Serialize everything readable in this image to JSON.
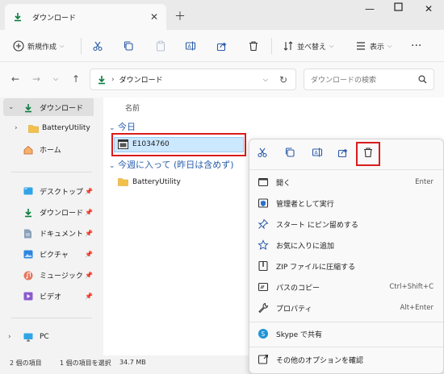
{
  "window": {
    "tab_title": "ダウンロード"
  },
  "toolbar": {
    "new_label": "新規作成",
    "sort_label": "並べ替え",
    "view_label": "表示"
  },
  "address": {
    "path": "ダウンロード",
    "search_placeholder": "ダウンロードの検索"
  },
  "nav": {
    "items": [
      {
        "label": "ダウンロード"
      },
      {
        "label": "BatteryUtility"
      },
      {
        "label": "ホーム"
      },
      {
        "label": "デスクトップ"
      },
      {
        "label": "ダウンロード"
      },
      {
        "label": "ドキュメント"
      },
      {
        "label": "ピクチャ"
      },
      {
        "label": "ミュージック"
      },
      {
        "label": "ビデオ"
      },
      {
        "label": "PC"
      }
    ]
  },
  "content": {
    "column_name": "名前",
    "groups": [
      {
        "label": "今日",
        "files": [
          "E1034760"
        ]
      },
      {
        "label": "今週に入って (昨日は含めず)",
        "files": [
          "BatteryUtility"
        ]
      }
    ]
  },
  "status": {
    "count": "2 個の項目",
    "selection": "1 個の項目を選択",
    "size": "34.7 MB"
  },
  "context_menu": {
    "items": [
      {
        "label": "開く",
        "shortcut": "Enter"
      },
      {
        "label": "管理者として実行",
        "shortcut": ""
      },
      {
        "label": "スタート にピン留めする",
        "shortcut": ""
      },
      {
        "label": "お気に入りに追加",
        "shortcut": ""
      },
      {
        "label": "ZIP ファイルに圧縮する",
        "shortcut": ""
      },
      {
        "label": "パスのコピー",
        "shortcut": "Ctrl+Shift+C"
      },
      {
        "label": "プロパティ",
        "shortcut": "Alt+Enter"
      },
      {
        "label": "Skype で共有",
        "shortcut": ""
      },
      {
        "label": "その他のオプションを確認",
        "shortcut": ""
      }
    ]
  },
  "colors": {
    "accent": "#0a7d3e",
    "folder": "#f3c14b",
    "highlight_red": "#d91c1c",
    "selection": "#cce8ff"
  }
}
